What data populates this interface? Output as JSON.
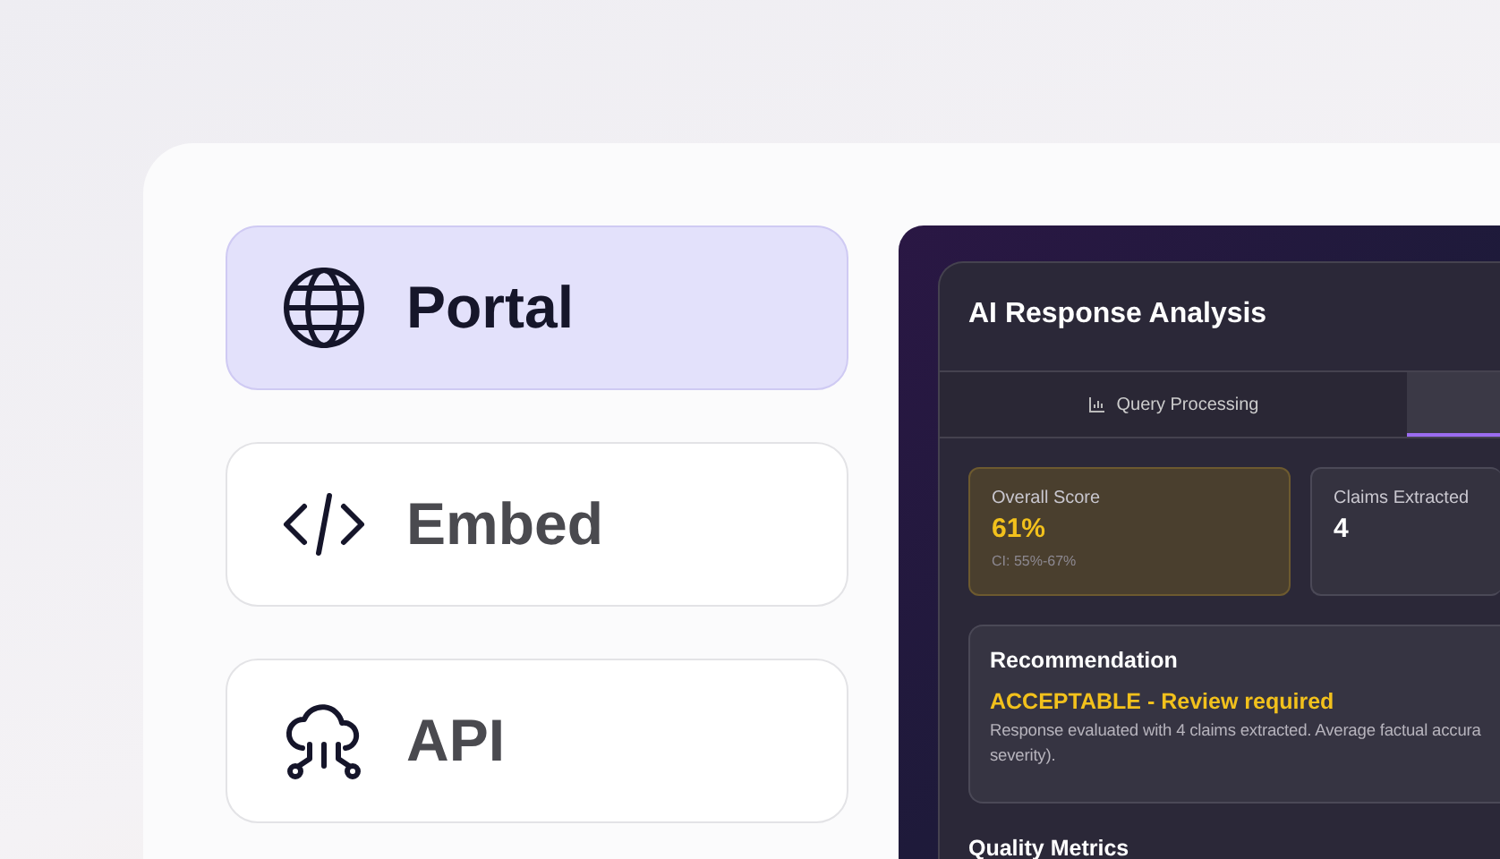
{
  "options": [
    {
      "label": "Portal",
      "selected": true
    },
    {
      "label": "Embed",
      "selected": false
    },
    {
      "label": "API",
      "selected": false
    }
  ],
  "analysis": {
    "title": "AI Response Analysis",
    "tabs": [
      {
        "label": "Query Processing",
        "selected": false
      },
      {
        "selected": true
      }
    ],
    "stats": [
      {
        "label": "Overall Score",
        "value": "61%",
        "note": "CI: 55%-67%",
        "kind": "highlight"
      },
      {
        "label": "Claims Extracted",
        "value": "4",
        "kind": "plain"
      }
    ],
    "recommendation": {
      "heading": "Recommendation",
      "verdict": "ACCEPTABLE - Review required",
      "lines": [
        "Response evaluated with 4 claims extracted. Average factual accura",
        "severity)."
      ]
    },
    "section_heading": "Quality Metrics"
  }
}
